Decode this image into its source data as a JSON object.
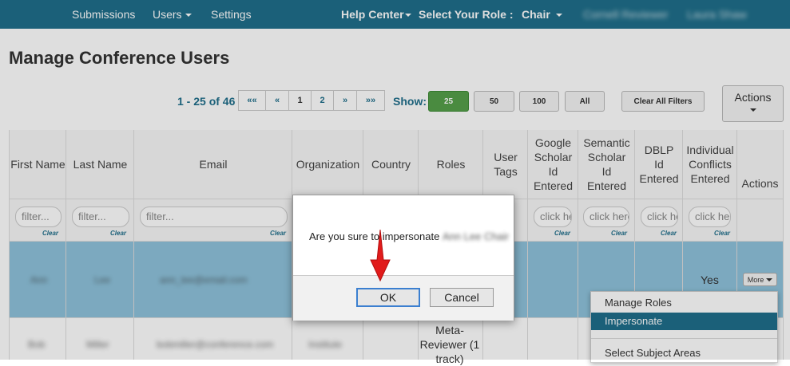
{
  "nav": {
    "submissions": "Submissions",
    "users": "Users",
    "settings": "Settings",
    "help_center": "Help Center",
    "select_role": "Select Your Role :",
    "role": "Chair",
    "blurred_1": "Cornell Reviewer",
    "blurred_2": "Laura Shaw"
  },
  "page": {
    "title": "Manage Conference Users"
  },
  "pager": {
    "count": "1 - 25 of 46",
    "first": "««",
    "prev": "«",
    "p1": "1",
    "p2": "2",
    "next": "»",
    "last": "»»",
    "show_label": "Show:",
    "show_25": "25",
    "show_50": "50",
    "show_100": "100",
    "show_all": "All",
    "clear_filters": "Clear All Filters",
    "actions": "Actions"
  },
  "table": {
    "headers": {
      "first_name": "First Name",
      "last_name": "Last Name",
      "email": "Email",
      "organization": "Organization",
      "country": "Country",
      "roles": "Roles",
      "user_tags": "User Tags",
      "google": "Google Scholar Id Entered",
      "semantic": "Semantic Scholar Id Entered",
      "dblp": "DBLP Id Entered",
      "conflicts": "Individual Conflicts Entered",
      "actions": "Actions"
    },
    "filter_placeholder": "filter...",
    "click_placeholder": "click here",
    "clear": "Clear",
    "row1": {
      "first": "Ann",
      "last": "Lee",
      "email": "ann_lee@email.com",
      "conflicts": "Yes",
      "more": "More"
    },
    "row2": {
      "first": "Bob",
      "last": "Miller",
      "email": "bobmiller@conference.com",
      "org": "Institute",
      "roles": "Meta-Reviewer (1 track)"
    }
  },
  "dropdown": {
    "manage_roles": "Manage Roles",
    "impersonate": "Impersonate",
    "select_subject": "Select Subject Areas"
  },
  "modal": {
    "message": "Are you sure to impersonate",
    "blurred_name": "Ann Lee Chair",
    "ok": "OK",
    "cancel": "Cancel"
  },
  "colors": {
    "nav": "#1f6f8b",
    "highlight_row": "#8fc3dc",
    "arrow": "#e11b1b",
    "active_show": "#55a04a"
  }
}
